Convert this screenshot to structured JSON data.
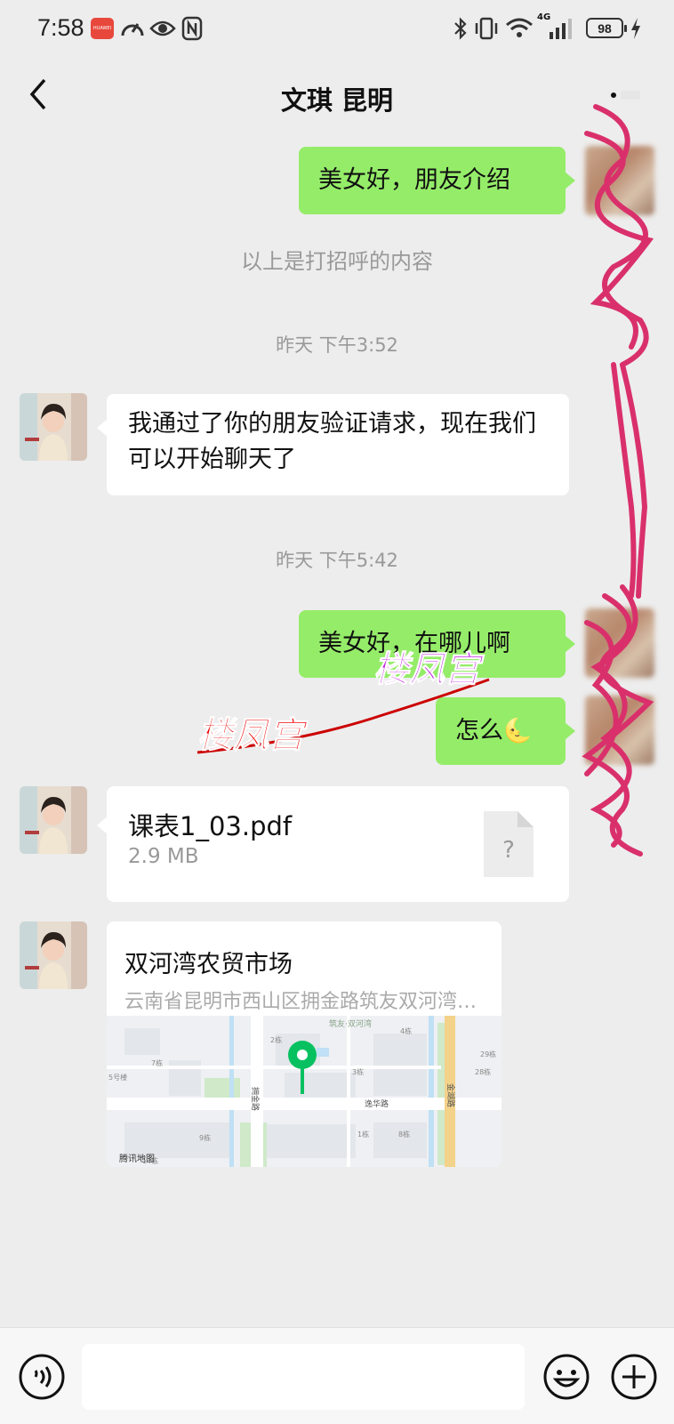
{
  "status_bar": {
    "time": "7:58",
    "battery": "98",
    "network": "4G"
  },
  "header": {
    "title": "文琪 昆明"
  },
  "messages": {
    "m1": "美女好，朋友介绍",
    "system_greeting": "以上是打招呼的内容",
    "time1": "昨天 下午3:52",
    "m2": "我通过了你的朋友验证请求，现在我们可以开始聊天了",
    "time2": "昨天 下午5:42",
    "m3": "美女好，在哪儿啊",
    "m4": "怎么",
    "m4_emoji": "🌜"
  },
  "file": {
    "name": "课表1_03.pdf",
    "size": "2.9 MB",
    "icon_mark": "?"
  },
  "location": {
    "title": "双河湾农贸市场",
    "address": "云南省昆明市西山区拥金路筑友双河湾…",
    "map_brand": "腾讯地图",
    "map_labels": {
      "road1": "逸华路",
      "road2": "拥金路",
      "road3": "金湖路",
      "poi": "筑友·双河湾",
      "b1": "2栋",
      "b2": "4栋",
      "b3": "7栋",
      "b4": "3栋",
      "b5": "1栋",
      "b6": "8栋",
      "b7": "29栋",
      "b8": "28栋",
      "b9": "5号楼",
      "b10": "9栋",
      "b11": "14栋"
    }
  },
  "watermark": {
    "text1": "楼凤宫",
    "text2": "楼凤宫"
  },
  "colors": {
    "my_bubble": "#95ec69",
    "other_bubble": "#ffffff",
    "background": "#ededed",
    "pin": "#07c160",
    "redaction": "#d9306b"
  },
  "icons": {
    "back": "chevron-left-icon",
    "more": "more-icon",
    "voice": "voice-icon",
    "emoji": "emoji-icon",
    "plus": "plus-icon"
  }
}
